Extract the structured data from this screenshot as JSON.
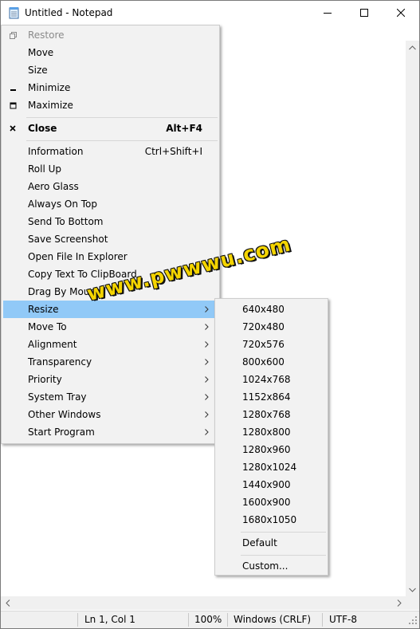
{
  "window": {
    "title": "Untitled - Notepad"
  },
  "statusbar": {
    "position": "Ln 1, Col 1",
    "zoom": "100%",
    "line_ending": "Windows (CRLF)",
    "encoding": "UTF-8"
  },
  "system_menu": {
    "items": [
      {
        "label": "Restore",
        "shortcut": "",
        "glyph": "restore-icon",
        "disabled": true
      },
      {
        "label": "Move",
        "shortcut": ""
      },
      {
        "label": "Size",
        "shortcut": ""
      },
      {
        "label": "Minimize",
        "shortcut": "",
        "glyph": "minimize-icon"
      },
      {
        "label": "Maximize",
        "shortcut": "",
        "glyph": "maximize-icon"
      },
      {
        "label": "Close",
        "shortcut": "Alt+F4",
        "glyph": "close-icon",
        "bold": true
      },
      {
        "label": "Information",
        "shortcut": "Ctrl+Shift+I"
      },
      {
        "label": "Roll Up"
      },
      {
        "label": "Aero Glass"
      },
      {
        "label": "Always On Top"
      },
      {
        "label": "Send To Bottom"
      },
      {
        "label": "Save Screenshot"
      },
      {
        "label": "Open File In Explorer"
      },
      {
        "label": "Copy Text To ClipBoard"
      },
      {
        "label": "Drag By Mouse"
      },
      {
        "label": "Resize",
        "submenu": true,
        "highlighted": true
      },
      {
        "label": "Move To",
        "submenu": true
      },
      {
        "label": "Alignment",
        "submenu": true
      },
      {
        "label": "Transparency",
        "submenu": true
      },
      {
        "label": "Priority",
        "submenu": true
      },
      {
        "label": "System Tray",
        "submenu": true
      },
      {
        "label": "Other Windows",
        "submenu": true
      },
      {
        "label": "Start Program",
        "submenu": true
      }
    ]
  },
  "resize_submenu": {
    "items": [
      "640x480",
      "720x480",
      "720x576",
      "800x600",
      "1024x768",
      "1152x864",
      "1280x768",
      "1280x800",
      "1280x960",
      "1280x1024",
      "1440x900",
      "1600x900",
      "1680x1050"
    ],
    "default_label": "Default",
    "custom_label": "Custom..."
  },
  "watermark": "www.pwwwu.com",
  "colors": {
    "highlight": "#91c9f7",
    "menu_bg": "#f2f2f2",
    "watermark": "#f4d400"
  }
}
